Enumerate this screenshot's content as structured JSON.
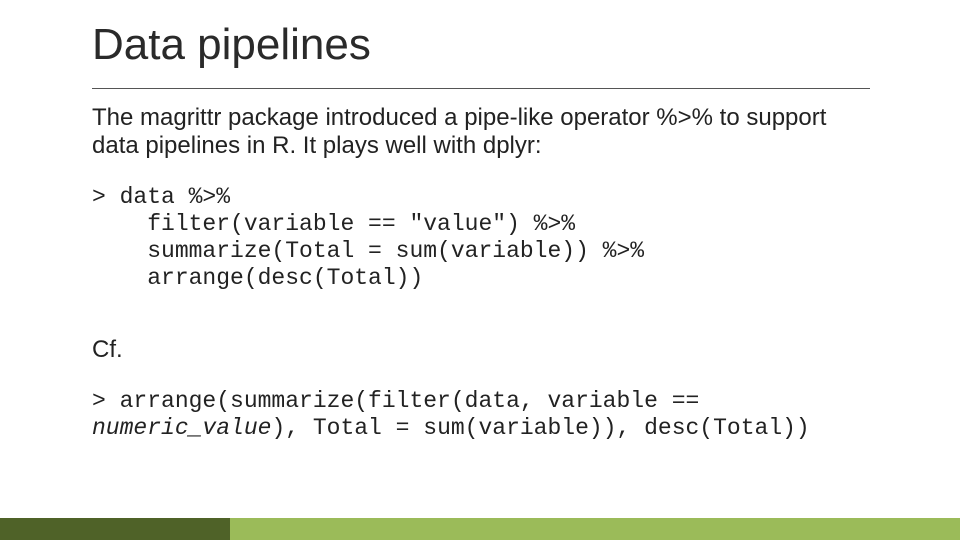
{
  "title": "Data pipelines",
  "intro": "The magrittr package introduced a pipe-like operator %>% to support data pipelines in R. It plays well with dplyr:",
  "code1": "> data %>%\n    filter(variable == \"value\") %>%\n    summarize(Total = sum(variable)) %>%\n    arrange(desc(Total))",
  "cf": "Cf.",
  "code2_prefix": "> arrange(summarize(filter(data, variable == ",
  "code2_italic": "numeric_value",
  "code2_suffix": "), Total = sum(variable)), desc(Total))"
}
